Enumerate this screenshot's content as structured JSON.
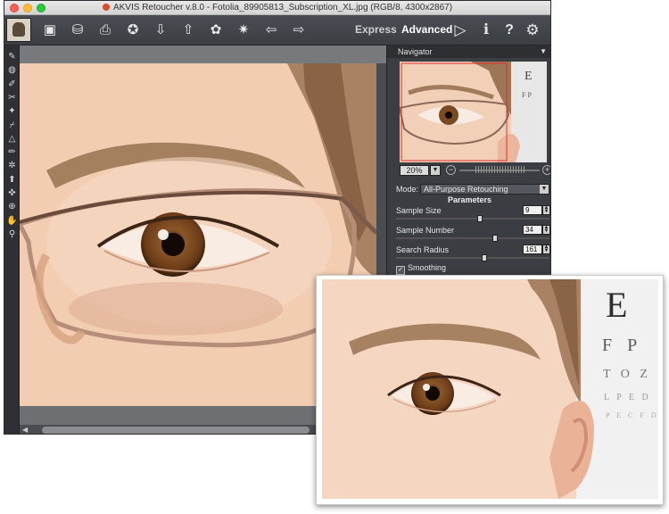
{
  "window": {
    "title": "AKVIS Retoucher v.8.0 - Fotolia_89905813_Subscription_XL.jpg (RGB/8, 4300x2867)"
  },
  "toolbar": {
    "buttons": [
      {
        "name": "open-button",
        "icon": "open-icon",
        "glyph": "▣"
      },
      {
        "name": "save-button",
        "icon": "save-icon",
        "glyph": "⛁"
      },
      {
        "name": "print-button",
        "icon": "print-icon",
        "glyph": "⎙"
      },
      {
        "name": "share-button",
        "icon": "share-icon",
        "glyph": "✪"
      },
      {
        "name": "import-button",
        "icon": "import-icon",
        "glyph": "⇩"
      },
      {
        "name": "export-button",
        "icon": "export-icon",
        "glyph": "⇧"
      },
      {
        "name": "batch-button",
        "icon": "batch-icon",
        "glyph": "✿"
      },
      {
        "name": "preferences-button",
        "icon": "gears-icon",
        "glyph": "✷"
      },
      {
        "name": "undo-button",
        "icon": "arrow-left-icon",
        "glyph": "⇦"
      },
      {
        "name": "redo-button",
        "icon": "arrow-right-icon",
        "glyph": "⇨"
      }
    ],
    "express_label": "Express",
    "advanced_label": "Advanced",
    "run_icon": "▷",
    "info_icon": "ℹ",
    "help_icon": "?",
    "settings_icon": "⚙"
  },
  "tools": [
    {
      "name": "tool-retouch",
      "glyph": "✎"
    },
    {
      "name": "tool-eraser",
      "glyph": "◍"
    },
    {
      "name": "tool-brush",
      "glyph": "✐"
    },
    {
      "name": "tool-patch",
      "glyph": "✂"
    },
    {
      "name": "tool-star",
      "glyph": "✦"
    },
    {
      "name": "tool-chisel",
      "glyph": "⌿"
    },
    {
      "name": "tool-triangle",
      "glyph": "△"
    },
    {
      "name": "tool-marker",
      "glyph": "✏"
    },
    {
      "name": "tool-gear",
      "glyph": "✲"
    },
    {
      "name": "tool-stamp",
      "glyph": "⬆"
    },
    {
      "name": "tool-crop",
      "glyph": "✜"
    },
    {
      "name": "tool-clone",
      "glyph": "⊕"
    },
    {
      "name": "tool-hand",
      "glyph": "✋"
    },
    {
      "name": "tool-zoom",
      "glyph": "⚲"
    }
  ],
  "navigator": {
    "title": "Navigator",
    "zoom": "20%"
  },
  "mode": {
    "label": "Mode:",
    "value": "All-Purpose Retouching"
  },
  "parameters": {
    "title": "Parameters",
    "items": [
      {
        "label": "Sample Size",
        "value": "9",
        "fraction": 0.55
      },
      {
        "label": "Sample Number",
        "value": "34",
        "fraction": 0.65
      },
      {
        "label": "Search Radius",
        "value": "161",
        "fraction": 0.58
      }
    ],
    "smoothing": {
      "label": "Smoothing",
      "checked": true
    }
  },
  "colors": {
    "panel": "#3a3d42",
    "skin": "#f3d2bb",
    "iris": "#7a4a22"
  }
}
